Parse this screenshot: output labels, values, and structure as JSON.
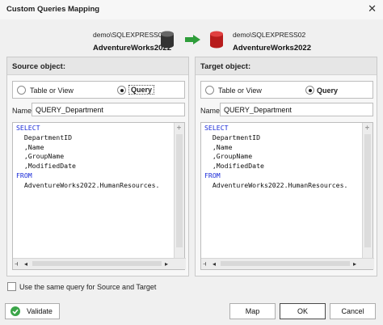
{
  "window": {
    "title": "Custom Queries Mapping",
    "close_glyph": "✕"
  },
  "source_connection": {
    "server": "demo\\SQLEXPRESS01",
    "database": "AdventureWorks2022",
    "icon": "database-icon",
    "color": "#333333"
  },
  "target_connection": {
    "server": "demo\\SQLEXPRESS02",
    "database": "AdventureWorks2022",
    "icon": "database-icon",
    "color": "#c62828"
  },
  "arrow": {
    "icon": "arrow-right-icon",
    "color": "#2e9d3a"
  },
  "source": {
    "header": "Source object:",
    "radio_table_label": "Table or View",
    "radio_query_label": "Query",
    "selected_mode": "Query",
    "name_label": "Name:",
    "name_value": "QUERY_Department",
    "query_lines": [
      {
        "text": "SELECT",
        "keyword": true
      },
      {
        "text": "  DepartmentID",
        "keyword": false
      },
      {
        "text": "  ,Name",
        "keyword": false
      },
      {
        "text": "  ,GroupName",
        "keyword": false
      },
      {
        "text": "  ,ModifiedDate",
        "keyword": false
      },
      {
        "text": "FROM",
        "keyword": true
      },
      {
        "text": "  AdventureWorks2022.HumanResources.",
        "keyword": false
      }
    ]
  },
  "target": {
    "header": "Target object:",
    "radio_table_label": "Table or View",
    "radio_query_label": "Query",
    "selected_mode": "Query",
    "name_label": "Name:",
    "name_value": "QUERY_Department",
    "query_lines": [
      {
        "text": "SELECT",
        "keyword": true
      },
      {
        "text": "  DepartmentID",
        "keyword": false
      },
      {
        "text": "  ,Name",
        "keyword": false
      },
      {
        "text": "  ,GroupName",
        "keyword": false
      },
      {
        "text": "  ,ModifiedDate",
        "keyword": false
      },
      {
        "text": "FROM",
        "keyword": true
      },
      {
        "text": "  AdventureWorks2022.HumanResources.",
        "keyword": false
      }
    ]
  },
  "same_query": {
    "label": "Use the same query for Source and Target",
    "checked": false
  },
  "buttons": {
    "validate": "Validate",
    "map": "Map",
    "ok": "OK",
    "cancel": "Cancel"
  },
  "colors": {
    "keyword": "#1a2bd8",
    "validate_icon": "#3aa548"
  }
}
